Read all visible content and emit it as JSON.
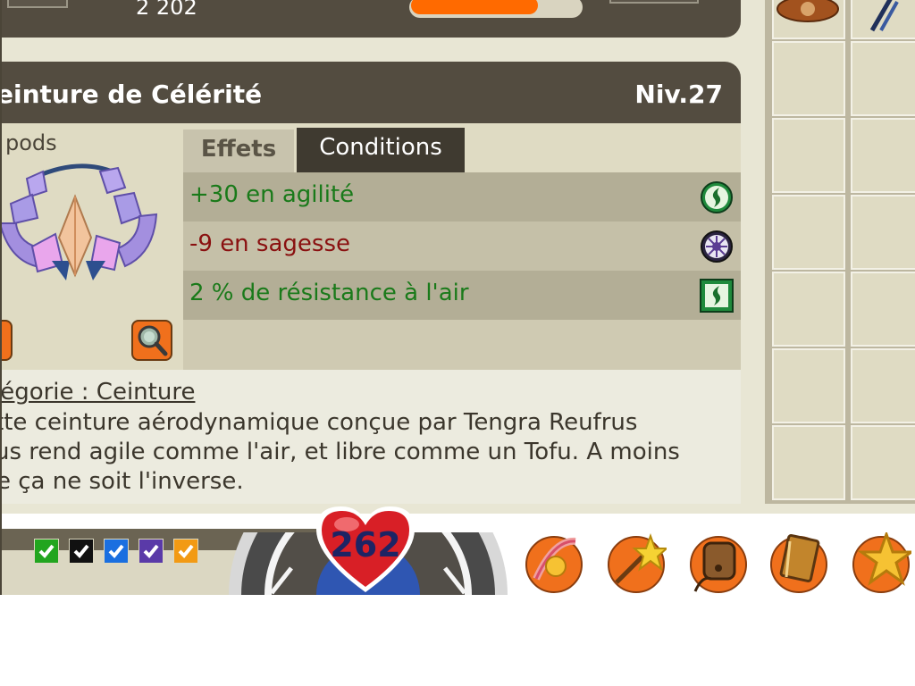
{
  "top_panel": {
    "number": "2 202",
    "bar_fill": 0.73
  },
  "item": {
    "title": "eeinture de Célérité",
    "title_visible": "einture de Célérité",
    "level": "Niv.27",
    "pods": "pods"
  },
  "tabs": [
    {
      "label": "Effets",
      "active": true
    },
    {
      "label": "Conditions",
      "active": false
    }
  ],
  "effects": [
    {
      "text": "+30 en agilité",
      "color": "#1a7a1a",
      "icon": "agility-icon"
    },
    {
      "text": "-9 en sagesse",
      "color": "#8a1010",
      "icon": "wisdom-icon"
    },
    {
      "text": "2 % de résistance à l'air",
      "color": "#1a7a1a",
      "icon": "air-resistance-icon"
    }
  ],
  "description": {
    "category": "tégorie : Ceinture",
    "lines": [
      "tte ceinture aérodynamique conçue par Tengra Reufrus",
      "us rend agile comme l'air, et libre comme un Tofu. A moins",
      "e ça ne soit l'inverse."
    ]
  },
  "hud": {
    "life": "262",
    "checkbox_colors": [
      "#22a51f",
      "#111111",
      "#1a6fe0",
      "#5a3aa8",
      "#f29a14"
    ]
  },
  "action_buttons": [
    "spells-icon",
    "wand-icon",
    "bag-icon",
    "book-icon",
    "star-icon"
  ],
  "colors": {
    "accent": "#ff6a00",
    "panel_dark": "#534c40",
    "bonus": "#1a7a1a",
    "malus": "#8a1010"
  }
}
